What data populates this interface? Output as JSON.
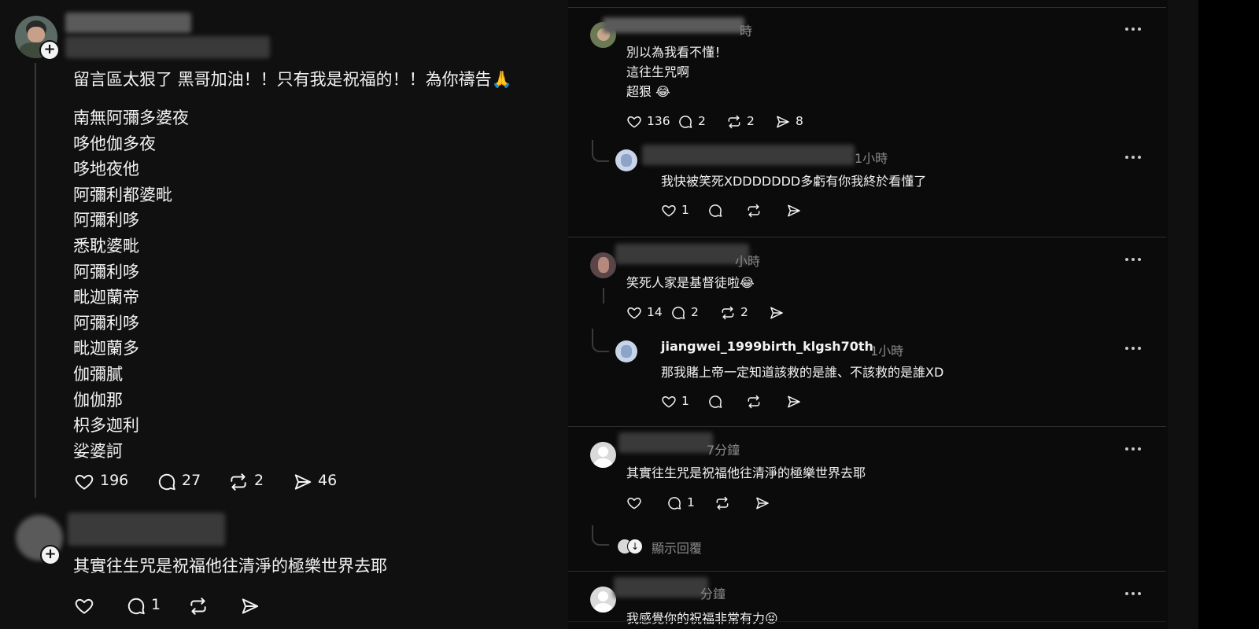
{
  "left_post": {
    "intro": "留言區太狠了 黑哥加油！！只有我是祝福的！！為你禱告🙏",
    "mantra": [
      "南無阿彌多婆夜",
      "哆他伽多夜",
      "哆地夜他",
      "阿彌利都婆毗",
      "阿彌利哆",
      "悉耽婆毗",
      "阿彌利哆",
      "毗迦蘭帝",
      "阿彌利哆",
      "毗迦蘭多",
      "伽彌膩",
      "伽伽那",
      "枳多迦利",
      "娑婆訶"
    ],
    "likes": "196",
    "replies": "27",
    "reposts": "2",
    "shares": "46"
  },
  "left_reply": {
    "text": "其實往生咒是祝福他往清淨的極樂世界去耶",
    "likes": "",
    "replies": "1",
    "reposts": "",
    "shares": ""
  },
  "right": {
    "c1": {
      "time": "時",
      "lines": [
        "別以為我看不懂！",
        "這往生咒啊",
        "超狠 😂"
      ],
      "likes": "136",
      "replies": "2",
      "reposts": "2",
      "shares": "8"
    },
    "c1r": {
      "time": "1小時",
      "text": "我快被笑死XDDDDDDD多虧有你我終於看懂了",
      "likes": "1"
    },
    "c2": {
      "time": "小時",
      "text": "笑死人家是基督徒啦😂",
      "likes": "14",
      "replies": "2",
      "reposts": "2"
    },
    "c2r": {
      "username": "jiangwei_1999birth_klgsh70th",
      "time": "1小時",
      "text": "那我賭上帝一定知道該救的是誰、不該救的是誰XD",
      "likes": "1"
    },
    "c3": {
      "time": "7分鐘",
      "text": "其實往生咒是祝福他往清淨的極樂世界去耶",
      "replies": "1",
      "show_replies": "顯示回覆"
    },
    "c4": {
      "time": "分鐘",
      "text": "我感覺你的祝福非常有力😝"
    }
  }
}
